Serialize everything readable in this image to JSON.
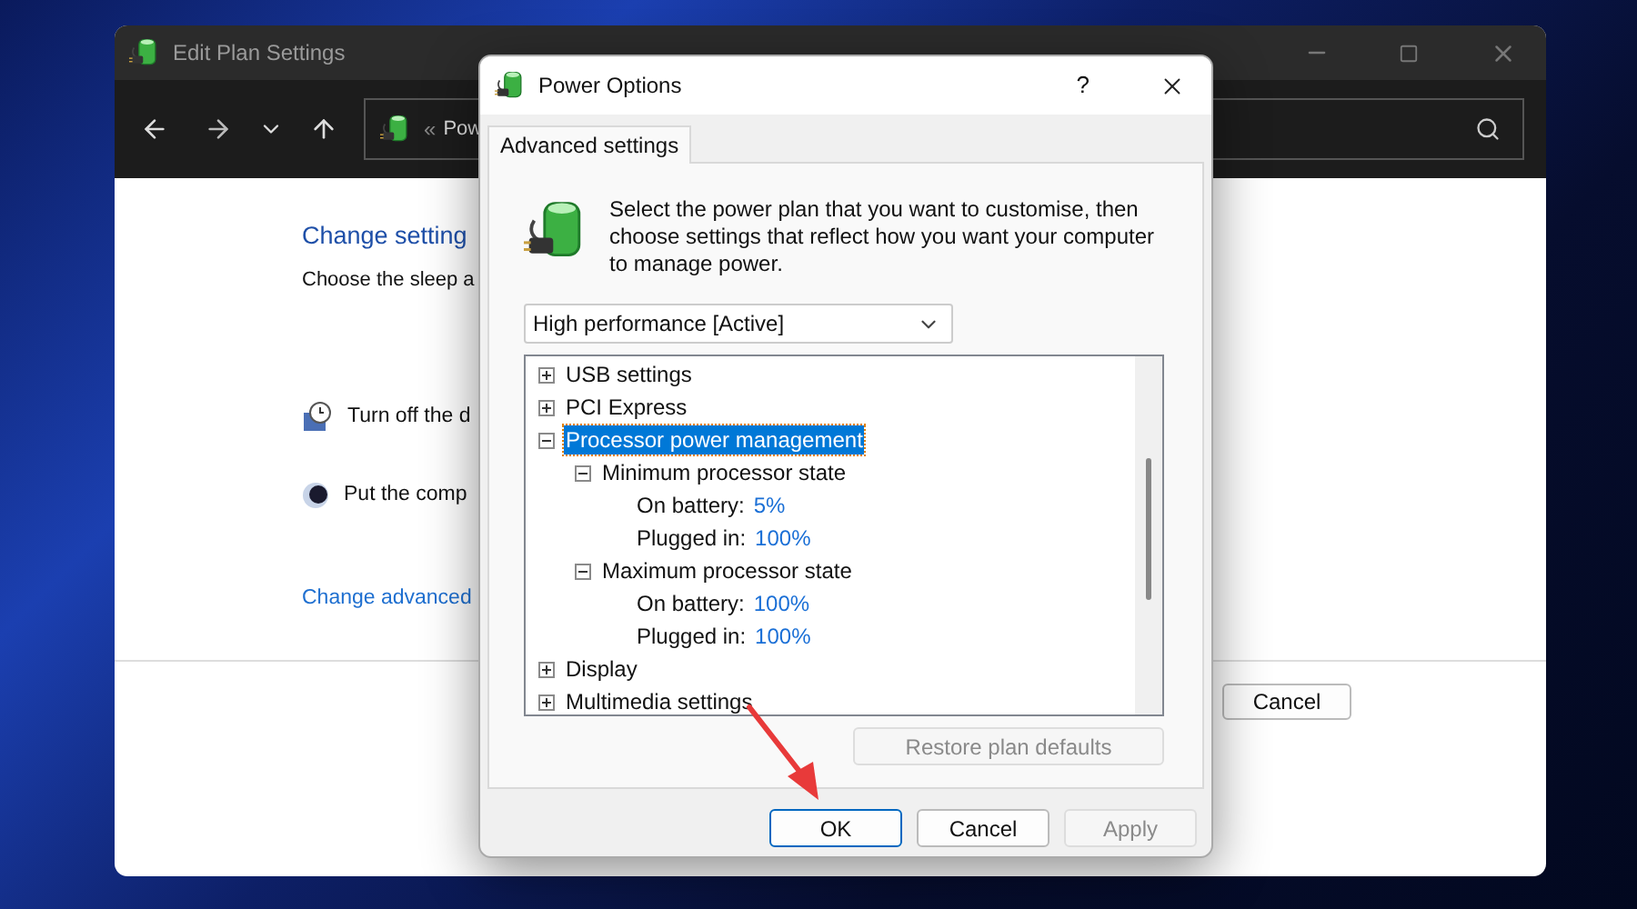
{
  "background_window": {
    "title": "Edit Plan Settings",
    "address_separator": "«",
    "address": "Pow",
    "heading": "Change setting",
    "subheading": "Choose the sleep a",
    "options": [
      {
        "kind": "display",
        "label": "Turn off the d"
      },
      {
        "kind": "sleep",
        "label": "Put the comp"
      }
    ],
    "link": "Change advanced",
    "cancel_button": "Cancel"
  },
  "dialog": {
    "title": "Power Options",
    "help": "?",
    "tabs": [
      {
        "label": "Advanced settings",
        "selected": true
      }
    ],
    "description": "Select the power plan that you want to customise, then choose settings that reflect how you want your computer to manage power.",
    "plan_select": {
      "value": "High performance [Active]"
    },
    "tree": [
      {
        "kind": "group",
        "label": "USB settings",
        "expanded": false,
        "selected": false
      },
      {
        "kind": "group",
        "label": "PCI Express",
        "expanded": false,
        "selected": false
      },
      {
        "kind": "group",
        "label": "Processor power management",
        "expanded": true,
        "selected": true,
        "children": [
          {
            "kind": "group",
            "label": "Minimum processor state",
            "expanded": true,
            "selected": false,
            "children": [
              {
                "kind": "setting",
                "label": "On battery:",
                "value": "5%",
                "selected": false
              },
              {
                "kind": "setting",
                "label": "Plugged in:",
                "value": "100%",
                "selected": false
              }
            ]
          },
          {
            "kind": "group",
            "label": "Maximum processor state",
            "expanded": true,
            "selected": false,
            "children": [
              {
                "kind": "setting",
                "label": "On battery:",
                "value": "100%",
                "selected": false
              },
              {
                "kind": "setting",
                "label": "Plugged in:",
                "value": "100%",
                "selected": false
              }
            ]
          }
        ]
      },
      {
        "kind": "group",
        "label": "Display",
        "expanded": false,
        "selected": false
      },
      {
        "kind": "group",
        "label": "Multimedia settings",
        "expanded": false,
        "selected": false
      }
    ],
    "restore_button": {
      "label": "Restore plan defaults",
      "disabled": true
    },
    "buttons": [
      {
        "label": "OK",
        "default": true,
        "disabled": false
      },
      {
        "label": "Cancel",
        "default": false,
        "disabled": false
      },
      {
        "label": "Apply",
        "default": false,
        "disabled": true
      }
    ]
  }
}
